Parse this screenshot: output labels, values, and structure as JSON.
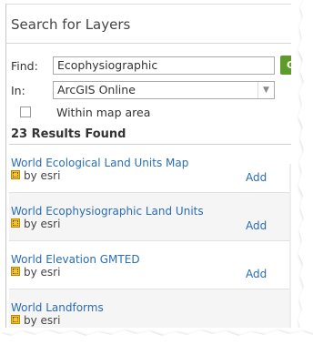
{
  "panel": {
    "title": "Search for Layers",
    "find_label": "Find:",
    "find_value": "Ecophysiographic",
    "go_label": "GO",
    "in_label": "In:",
    "in_value": "ArcGIS Online",
    "within_map_label": "Within map area",
    "within_map_checked": false,
    "results_count": "23 Results Found"
  },
  "results": [
    {
      "title": "World Ecological Land Units Map",
      "by": "by esri",
      "add": "Add",
      "icon": "map-layer-icon"
    },
    {
      "title": "World Ecophysiographic Land Units",
      "by": "by esri",
      "add": "Add",
      "icon": "map-layer-icon"
    },
    {
      "title": "World Elevation GMTED",
      "by": "by esri",
      "add": "Add",
      "icon": "map-layer-icon"
    },
    {
      "title": "World Landforms",
      "by": "by esri",
      "add": "",
      "icon": "map-layer-icon"
    }
  ],
  "colors": {
    "link": "#2a6db5",
    "go_button": "#5d9b2a",
    "icon": "#f1c232"
  }
}
